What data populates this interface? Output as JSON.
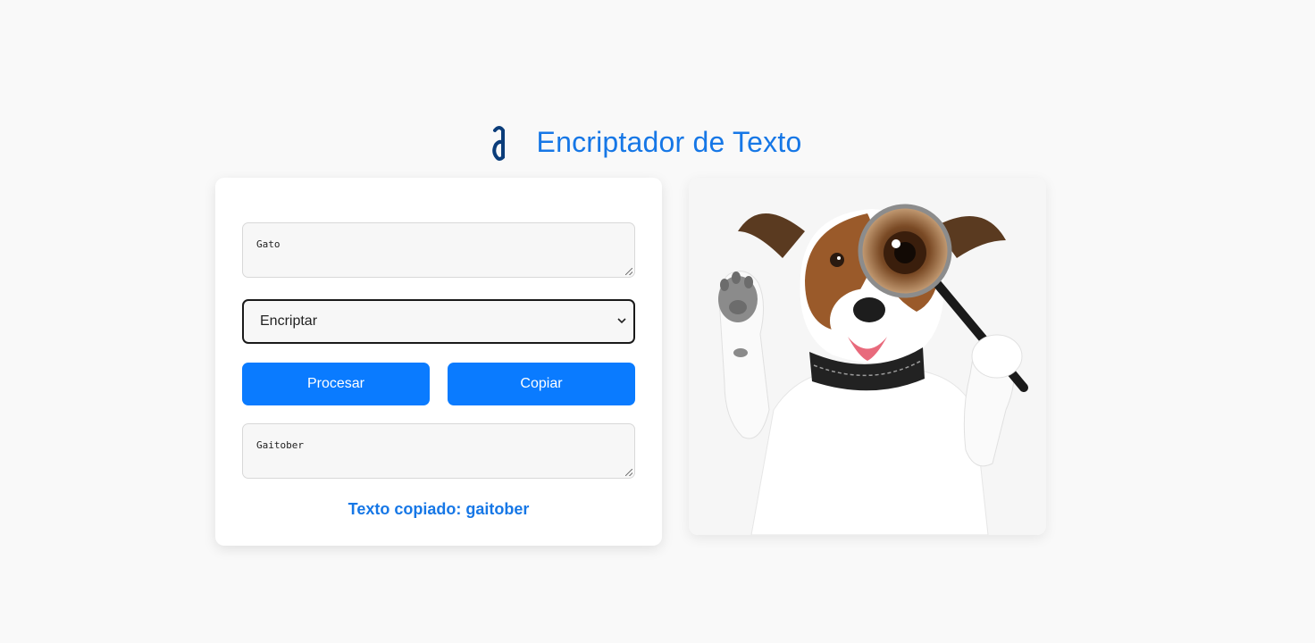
{
  "header": {
    "title": "Encriptador de Texto",
    "logo_icon": "alura-logo-icon",
    "accent_color": "#1677e6"
  },
  "form": {
    "input_text": "Gato",
    "mode_select": {
      "selected": "Encriptar",
      "options": [
        "Encriptar"
      ]
    },
    "process_button": "Procesar",
    "copy_button": "Copiar",
    "output_text": "Gaitober",
    "status_message": "Texto copiado: gaitober",
    "button_color": "#0a7bff"
  },
  "illustration": {
    "icon": "dog-with-magnifier-illustration"
  }
}
